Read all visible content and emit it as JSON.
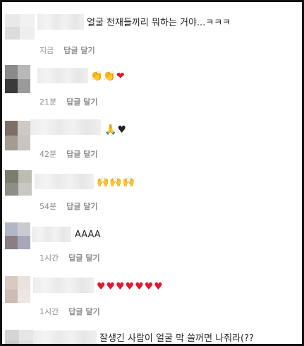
{
  "comments": [
    {
      "text": "얼굴 천재들끼리 뭐하는 거야...ㅋㅋㅋ",
      "time": "지금",
      "reply": "답글 달기"
    },
    {
      "text": "👏👏❤️",
      "time": "21분",
      "reply": "답글 달기"
    },
    {
      "text": "🙏🖤",
      "time": "42분",
      "reply": "답글 달기"
    },
    {
      "text": "🙌🙌🙌",
      "time": "54분",
      "reply": "답글 달기"
    },
    {
      "text": "AAAA",
      "time": "1시간",
      "reply": "답글 달기"
    },
    {
      "text": "❤️❤️❤️❤️❤️❤️❤️",
      "time": "1시간",
      "reply": "답글 달기"
    },
    {
      "text": "잘생긴 사람이 얼굴 막 쓸꺼면 나줘라(??",
      "time": "",
      "reply": ""
    }
  ],
  "colors": {
    "text": "#262626",
    "meta": "#8e8e8e",
    "heart": "#e0182d"
  }
}
